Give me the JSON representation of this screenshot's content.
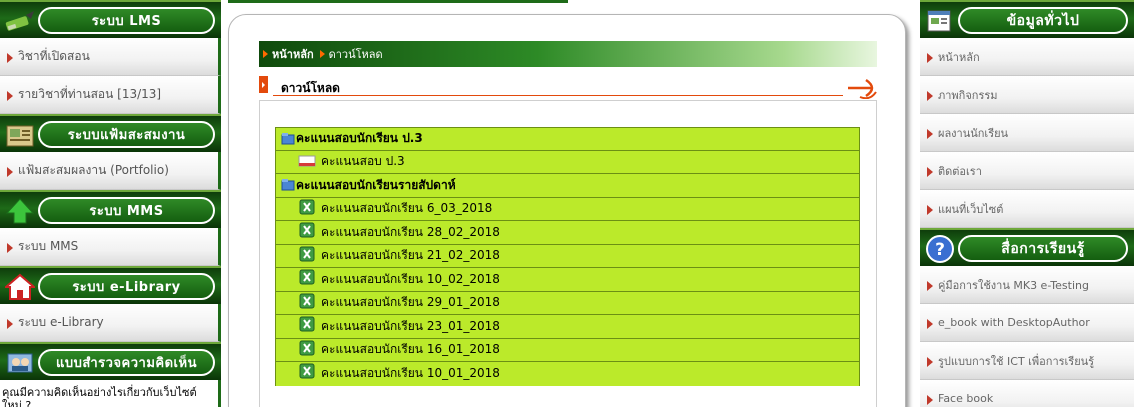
{
  "left_sidebar": {
    "sections": [
      {
        "title": "ระบบ LMS",
        "icon": "pencil-icon",
        "items": [
          "วิชาที่เปิดสอน",
          "รายวิชาที่ท่านสอน [13/13]"
        ]
      },
      {
        "title": "ระบบแฟ้มสะสมงาน",
        "icon": "portfolio-icon",
        "items": [
          "แฟ้มสะสมผลงาน (Portfolio)"
        ]
      },
      {
        "title": "ระบบ MMS",
        "icon": "up-arrow-icon",
        "items": [
          "ระบบ MMS"
        ]
      },
      {
        "title": "ระบบ e-Library",
        "icon": "home-icon",
        "items": [
          "ระบบ e-Library"
        ]
      },
      {
        "title": "แบบสำรวจความคิดเห็น",
        "icon": "survey-icon",
        "text": "คุณมีความคิดเห็นอย่างไรเกี่ยวกับเว็บไซต์ใหม่ ?"
      }
    ]
  },
  "breadcrumb": {
    "home": "หน้าหลัก",
    "current": "ดาวน์โหลด"
  },
  "downloads": {
    "title": "ดาวน์โหลด",
    "rows": [
      {
        "type": "category",
        "label": "คะแนนสอบนักเรียน ป.3"
      },
      {
        "type": "file",
        "label": "คะแนนสอบ ป.3"
      },
      {
        "type": "category",
        "label": "คะแนนสอบนักเรียนรายสัปดาห์"
      },
      {
        "type": "file",
        "label": "คะแนนสอบนักเรียน 6_03_2018"
      },
      {
        "type": "file",
        "label": "คะแนนสอบนักเรียน 28_02_2018"
      },
      {
        "type": "file",
        "label": "คะแนนสอบนักเรียน 21_02_2018"
      },
      {
        "type": "file",
        "label": "คะแนนสอบนักเรียน 10_02_2018"
      },
      {
        "type": "file",
        "label": "คะแนนสอบนักเรียน 29_01_2018"
      },
      {
        "type": "file",
        "label": "คะแนนสอบนักเรียน 23_01_2018"
      },
      {
        "type": "file",
        "label": "คะแนนสอบนักเรียน 16_01_2018"
      },
      {
        "type": "file",
        "label": "คะแนนสอบนักเรียน 10_01_2018"
      }
    ]
  },
  "right_sidebar": {
    "sections": [
      {
        "title": "ข้อมูลทั่วไป",
        "icon": "info-window-icon",
        "items": [
          "หน้าหลัก",
          "ภาพกิจกรรม",
          "ผลงานนักเรียน",
          "ติดต่อเรา",
          "แผนที่เว็บไซต์"
        ]
      },
      {
        "title": "สื่อการเรียนรู้",
        "icon": "help-icon",
        "items": [
          "คู่มือการใช้งาน MK3 e-Testing",
          "e_book with DesktopAuthor",
          "รูปแบบการใช้ ICT เพื่อการเรียนรู้",
          "Face book"
        ]
      }
    ]
  },
  "colors": {
    "sidebar_green": "#1e6b18",
    "row_lime": "#bbea2a",
    "accent_orange": "#e34a0c"
  }
}
